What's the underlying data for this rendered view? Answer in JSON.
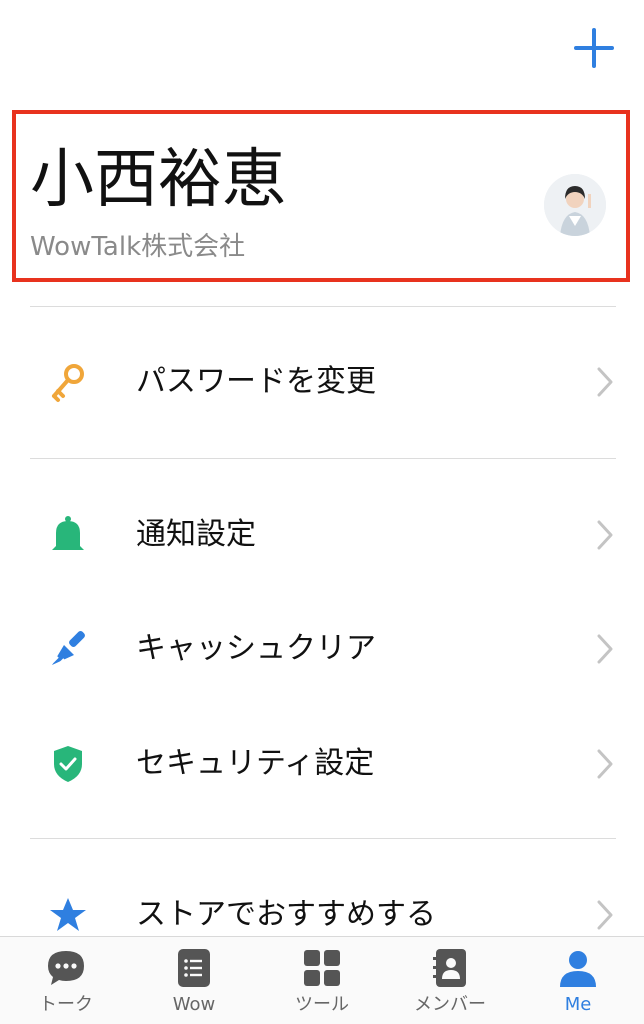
{
  "header": {
    "add_icon": "plus-icon"
  },
  "profile": {
    "name": "小西裕恵",
    "company": "WowTalk株式会社",
    "avatar_icon": "user-photo"
  },
  "menu": {
    "items": [
      {
        "label": "パスワードを変更",
        "icon": "key-icon",
        "color": "#f0a63a"
      },
      {
        "label": "通知設定",
        "icon": "bell-icon",
        "color": "#28b67a"
      },
      {
        "label": "キャッシュクリア",
        "icon": "brush-icon",
        "color": "#2f7fe0"
      },
      {
        "label": "セキュリティ設定",
        "icon": "shield-check-icon",
        "color": "#28b67a"
      },
      {
        "label": "ストアでおすすめする",
        "icon": "star-icon",
        "color": "#2f7fe0"
      }
    ]
  },
  "tabs": [
    {
      "label": "トーク",
      "icon": "chat-bubble-icon",
      "active": false
    },
    {
      "label": "Wow",
      "icon": "note-icon",
      "active": false
    },
    {
      "label": "ツール",
      "icon": "grid-icon",
      "active": false
    },
    {
      "label": "メンバー",
      "icon": "contacts-icon",
      "active": false
    },
    {
      "label": "Me",
      "icon": "person-icon",
      "active": true
    }
  ],
  "colors": {
    "accent": "#2f7fe0",
    "highlight_border": "#e8321e",
    "inactive_tab": "#666666"
  }
}
